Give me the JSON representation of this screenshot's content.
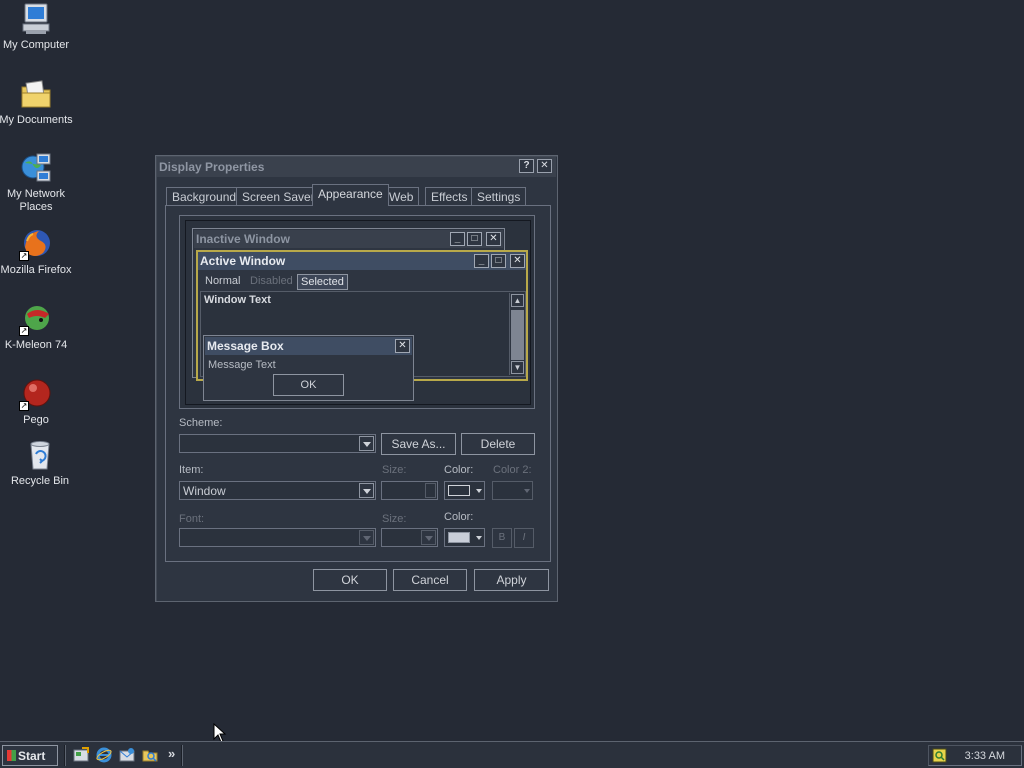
{
  "desktop": {
    "icons": [
      {
        "label_1": "My Computer",
        "icon": "computer-icon"
      },
      {
        "label_1": "My Documents",
        "icon": "folder-documents-icon"
      },
      {
        "label_1": "My Network",
        "label_2": "Places",
        "icon": "network-icon"
      },
      {
        "label_1": "Mozilla Firefox",
        "icon": "firefox-icon"
      },
      {
        "label_1": "K-Meleon 74",
        "icon": "kmeleon-icon"
      },
      {
        "label_1": "Pego",
        "icon": "pego-icon"
      },
      {
        "label_1": "Recycle Bin",
        "icon": "recycle-bin-icon"
      }
    ]
  },
  "dialog": {
    "title": "Display Properties",
    "help_glyph": "?",
    "close_glyph": "✕",
    "tabs": [
      "Background",
      "Screen Saver",
      "Appearance",
      "Web",
      "Effects",
      "Settings"
    ],
    "active_tab": "Appearance",
    "preview": {
      "inactive_title": "Inactive Window",
      "active_title": "Active Window",
      "menu_normal": "Normal",
      "menu_disabled": "Disabled",
      "menu_selected": "Selected",
      "window_text": "Window Text",
      "msgbox_title": "Message Box",
      "msgbox_text": "Message Text",
      "msgbox_ok": "OK"
    },
    "scheme_label": "Scheme:",
    "scheme_value": "",
    "save_as_label": "Save As...",
    "delete_label": "Delete",
    "item_label": "Item:",
    "item_value": "Window",
    "size_label": "Size:",
    "color_label": "Color:",
    "color2_label": "Color 2:",
    "font_label": "Font:",
    "font_size_label": "Size:",
    "font_color_label": "Color:",
    "bold_label": "B",
    "italic_label": "I",
    "ok_label": "OK",
    "cancel_label": "Cancel",
    "apply_label": "Apply"
  },
  "taskbar": {
    "start_label": "Start",
    "chevron": "»",
    "clock": "3:33 AM"
  },
  "colors": {
    "desktop": "#252a35",
    "active_title_bg": "#3f4d63",
    "selected_menu_bg": "#3d4657",
    "highlight_border": "#b8a94a"
  }
}
